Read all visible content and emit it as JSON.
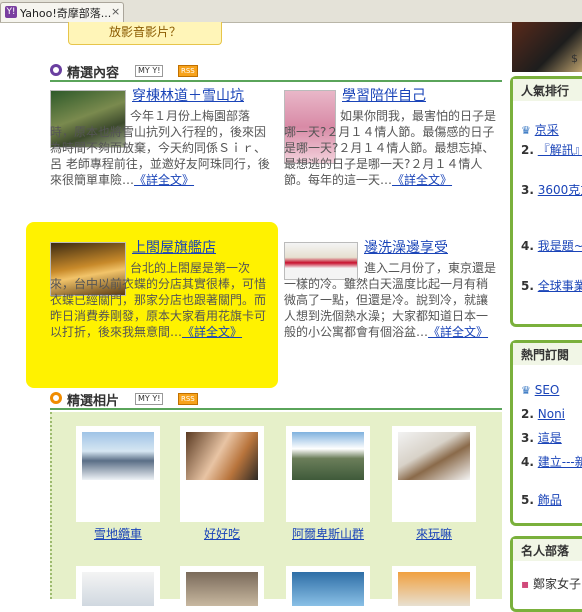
{
  "browser": {
    "tab_title": "Yahoo!奇摩部落...",
    "favicon": "Y!",
    "close": "×"
  },
  "top_button": "放影音影片？",
  "featured": {
    "title": "精選內容",
    "my_badge": "MY Y!",
    "rss_badge": "RSS",
    "articles": [
      {
        "title": "穿棟林道＋雪山坑",
        "body": "今年１月份上梅園部落時，原本也將雪山抗列入行程的，後來因為時間不夠而放棄，今天約同係Ｓｉｒ、呂 老師專程前往，並邀好友阿珠同行，後來很簡單車險…",
        "more": "《詳全文》"
      },
      {
        "title": "學習陪伴自己",
        "body": "如果你問我，最害怕的日子是哪一天?２月１４情人節。最傷感的日子是哪一天?２月１４情人節。最想忘掉、最想逃的日子是哪一天?２月１４情人節。每年的這一天…",
        "more": "《詳全文》"
      },
      {
        "title": "上閤屋旗艦店",
        "body": "台北的上閤屋是第一次來，台中以前衣蝶的分店其實很棒，可惜衣蝶已經關門，那家分店也跟著關門。而昨日消費券剛發，原本大家看用花旗卡可以打折，後來我無意間…",
        "more": "《詳全文》"
      },
      {
        "title": "邊洗澡邊享受",
        "body": "進入二月份了，東京還是一樣的冷。雖然白天溫度比起一月有稍微高了一點，但還是冷。說到冷，就讓人想到洗個熱水澡；大家都知道日本一般的小公寓都會有個浴盆…",
        "more": "《詳全文》"
      }
    ]
  },
  "photos": {
    "title": "精選相片",
    "my_badge": "MY Y!",
    "rss_badge": "RSS",
    "items": [
      {
        "caption": "雪地纜車"
      },
      {
        "caption": "好好吃"
      },
      {
        "caption": "阿爾卑斯山群"
      },
      {
        "caption": "來玩嘛"
      }
    ]
  },
  "right": {
    "ranking": {
      "title": "人氣排行",
      "items": [
        {
          "num": "",
          "text": "京采"
        },
        {
          "num": "2.",
          "text": "『解訊』"
        },
        {
          "num": "3.",
          "text": "3600克方配送"
        },
        {
          "num": "4.",
          "text": "我是題~動"
        },
        {
          "num": "5.",
          "text": "全球事業"
        }
      ]
    },
    "hot": {
      "title": "熱門訂閱",
      "items": [
        {
          "num": "",
          "text": "SEO"
        },
        {
          "num": "2.",
          "text": "Noni"
        },
        {
          "num": "3.",
          "text": "這是"
        },
        {
          "num": "4.",
          "text": "建立---新"
        },
        {
          "num": "5.",
          "text": "飾品"
        }
      ]
    },
    "celeb": {
      "title": "名人部落",
      "items": [
        {
          "text": "鄭家女子"
        }
      ]
    },
    "price_fragment": "$"
  },
  "colors": {
    "accent_green": "#5aa45a",
    "highlight": "#fff200",
    "link": "#1a44b8"
  }
}
